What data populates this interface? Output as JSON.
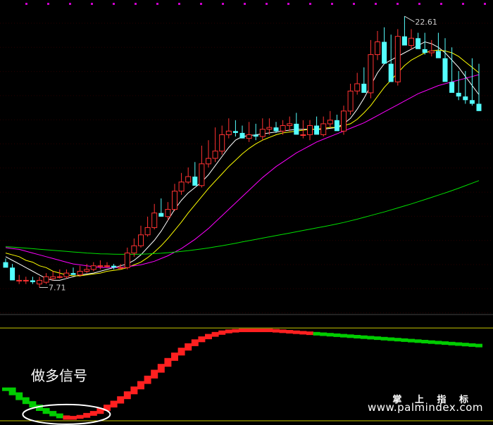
{
  "colors": {
    "background": "#000000",
    "grid": "#2a0000",
    "candle_up": "#ff3232",
    "candle_down": "#54ffff",
    "ma5": "#ffffff",
    "ma10": "#ffff00",
    "ma20": "#ff00ff",
    "ma60": "#00e000",
    "indicator_up": "#ff2020",
    "indicator_down": "#00cc00",
    "indicator_line": "#c8c800",
    "ellipse": "#ffffff",
    "dots": "#cc00cc"
  },
  "annotations": {
    "signal_label": "做多信号",
    "high_label": "22.61",
    "low_label": "7.71"
  },
  "watermark": {
    "name": "掌 上 指 标",
    "url": "www.palmindex.com"
  },
  "chart_data": [
    {
      "type": "candlestick",
      "x": [
        1,
        2,
        3,
        4,
        5,
        6,
        7,
        8,
        9,
        10,
        11,
        12,
        13,
        14,
        15,
        16,
        17,
        18,
        19,
        20,
        21,
        22,
        23,
        24,
        25,
        26,
        27,
        28,
        29,
        30,
        31,
        32,
        33,
        34,
        35,
        36,
        37,
        38,
        39,
        40,
        41,
        42,
        43,
        44,
        45,
        46,
        47,
        48,
        49,
        50,
        51,
        52,
        53,
        54,
        55,
        56,
        57,
        58,
        59,
        60,
        61,
        62,
        63,
        64,
        65,
        66,
        67,
        68,
        69,
        70,
        71
      ],
      "open": [
        9.1,
        8.8,
        8.1,
        8.1,
        8.1,
        7.9,
        8.0,
        8.2,
        8.3,
        8.3,
        8.5,
        8.4,
        8.6,
        8.7,
        8.9,
        8.9,
        8.9,
        8.8,
        8.8,
        9.6,
        10.0,
        10.6,
        11.0,
        11.8,
        11.6,
        12.0,
        13.0,
        13.5,
        13.8,
        13.3,
        14.5,
        14.8,
        15.2,
        16.1,
        16.3,
        16.2,
        15.9,
        16.1,
        16.0,
        16.4,
        16.5,
        16.3,
        16.6,
        16.7,
        16.1,
        16.1,
        16.6,
        16.1,
        16.7,
        16.9,
        16.3,
        17.4,
        18.5,
        18.9,
        18.4,
        20.5,
        21.2,
        20.0,
        19.0,
        21.5,
        21.0,
        21.4,
        20.8,
        20.6,
        20.7,
        20.3,
        19.0,
        18.4,
        18.2,
        18.0,
        17.8
      ],
      "high": [
        9.3,
        9.0,
        8.4,
        8.3,
        8.3,
        8.3,
        8.5,
        8.6,
        8.7,
        8.7,
        8.8,
        8.9,
        9.0,
        9.1,
        9.2,
        9.1,
        9.0,
        9.0,
        9.9,
        10.4,
        11.1,
        11.6,
        12.3,
        12.6,
        12.4,
        13.4,
        14.0,
        14.3,
        14.6,
        15.5,
        15.8,
        16.5,
        16.6,
        17.0,
        16.9,
        16.6,
        16.8,
        16.7,
        17.0,
        17.0,
        16.8,
        16.9,
        17.1,
        17.3,
        16.9,
        16.9,
        17.1,
        17.1,
        17.4,
        17.2,
        17.7,
        18.9,
        19.5,
        19.8,
        21.3,
        21.8,
        22.0,
        21.6,
        21.9,
        22.61,
        21.9,
        21.7,
        21.7,
        21.3,
        21.7,
        21.4,
        20.9,
        19.6,
        19.6,
        20.3,
        20.0
      ],
      "low": [
        8.9,
        8.7,
        7.9,
        7.9,
        7.9,
        7.71,
        7.9,
        8.1,
        8.2,
        8.2,
        8.4,
        8.3,
        8.5,
        8.6,
        8.7,
        8.8,
        8.7,
        8.7,
        8.7,
        9.4,
        9.9,
        10.5,
        10.9,
        11.6,
        11.4,
        11.9,
        12.8,
        13.4,
        13.6,
        13.2,
        14.3,
        14.6,
        15.0,
        15.9,
        16.0,
        15.9,
        15.7,
        15.8,
        15.8,
        16.1,
        16.2,
        16.1,
        16.3,
        16.4,
        15.9,
        15.8,
        16.3,
        16.0,
        16.5,
        16.5,
        16.1,
        17.2,
        18.3,
        18.6,
        18.1,
        20.2,
        20.9,
        19.7,
        18.8,
        21.2,
        20.8,
        21.2,
        20.5,
        20.4,
        20.4,
        20.0,
        18.6,
        18.0,
        17.8,
        17.7,
        17.4
      ],
      "close": [
        8.8,
        8.1,
        8.1,
        8.1,
        8.0,
        8.1,
        8.3,
        8.3,
        8.3,
        8.5,
        8.4,
        8.6,
        8.7,
        8.9,
        8.9,
        8.9,
        8.8,
        8.8,
        9.6,
        10.0,
        10.6,
        11.0,
        11.8,
        11.6,
        12.0,
        13.0,
        13.5,
        13.8,
        13.3,
        14.5,
        14.8,
        15.2,
        16.1,
        16.3,
        16.2,
        15.9,
        16.1,
        16.0,
        16.4,
        16.5,
        16.3,
        16.6,
        16.7,
        16.1,
        16.1,
        16.6,
        16.1,
        16.7,
        16.9,
        16.3,
        17.4,
        18.5,
        18.9,
        18.4,
        20.5,
        21.2,
        20.0,
        19.0,
        21.5,
        21.0,
        21.4,
        20.8,
        20.6,
        20.7,
        20.3,
        19.0,
        18.4,
        18.2,
        18.0,
        17.8,
        17.4
      ],
      "moving_averages": [
        {
          "name": "MA5",
          "values": [
            9.4,
            9.2,
            9.0,
            8.8,
            8.6,
            8.4,
            8.2,
            8.1,
            8.1,
            8.2,
            8.3,
            8.4,
            8.45,
            8.5,
            8.6,
            8.7,
            8.8,
            8.9,
            9.0,
            9.2,
            9.5,
            9.9,
            10.3,
            10.8,
            11.4,
            12.0,
            12.5,
            12.9,
            13.2,
            13.5,
            13.9,
            14.4,
            14.9,
            15.4,
            15.8,
            16.0,
            16.05,
            16.1,
            16.15,
            16.2,
            16.25,
            16.3,
            16.35,
            16.4,
            16.4,
            16.4,
            16.4,
            16.4,
            16.45,
            16.5,
            16.7,
            17.0,
            17.5,
            18.1,
            18.8,
            19.5,
            20.0,
            20.2,
            20.4,
            20.6,
            20.8,
            21.0,
            21.2,
            21.1,
            20.9,
            20.6,
            20.2,
            19.8,
            19.3,
            18.8,
            18.3
          ]
        },
        {
          "name": "MA10",
          "values": [
            9.6,
            9.5,
            9.4,
            9.2,
            9.1,
            8.9,
            8.8,
            8.6,
            8.5,
            8.4,
            8.35,
            8.35,
            8.4,
            8.45,
            8.5,
            8.6,
            8.65,
            8.7,
            8.8,
            8.95,
            9.1,
            9.35,
            9.65,
            10.0,
            10.4,
            10.85,
            11.3,
            11.8,
            12.25,
            12.7,
            13.15,
            13.55,
            13.95,
            14.35,
            14.7,
            15.05,
            15.35,
            15.6,
            15.8,
            15.95,
            16.1,
            16.2,
            16.25,
            16.3,
            16.35,
            16.4,
            16.4,
            16.45,
            16.5,
            16.5,
            16.6,
            16.7,
            16.95,
            17.3,
            17.7,
            18.2,
            18.7,
            19.1,
            19.5,
            19.9,
            20.2,
            20.4,
            20.6,
            20.7,
            20.75,
            20.7,
            20.6,
            20.4,
            20.1,
            19.8,
            19.5
          ]
        },
        {
          "name": "MA20",
          "values": [
            9.9,
            9.85,
            9.8,
            9.7,
            9.6,
            9.5,
            9.4,
            9.3,
            9.2,
            9.1,
            9.0,
            8.95,
            8.9,
            8.85,
            8.8,
            8.8,
            8.8,
            8.8,
            8.85,
            8.9,
            8.95,
            9.05,
            9.15,
            9.3,
            9.45,
            9.65,
            9.85,
            10.1,
            10.35,
            10.65,
            10.95,
            11.3,
            11.65,
            12.0,
            12.35,
            12.7,
            13.05,
            13.4,
            13.75,
            14.05,
            14.35,
            14.6,
            14.85,
            15.1,
            15.3,
            15.5,
            15.7,
            15.85,
            16.0,
            16.15,
            16.3,
            16.45,
            16.6,
            16.75,
            16.95,
            17.15,
            17.35,
            17.55,
            17.75,
            17.95,
            18.15,
            18.35,
            18.5,
            18.65,
            18.8,
            18.9,
            19.0,
            19.1,
            19.2,
            19.3,
            19.4
          ]
        },
        {
          "name": "MA60",
          "values": [
            9.95,
            9.93,
            9.9,
            9.87,
            9.84,
            9.81,
            9.78,
            9.75,
            9.72,
            9.69,
            9.66,
            9.63,
            9.6,
            9.58,
            9.56,
            9.55,
            9.54,
            9.53,
            9.53,
            9.53,
            9.54,
            9.55,
            9.57,
            9.59,
            9.62,
            9.65,
            9.69,
            9.73,
            9.78,
            9.83,
            9.88,
            9.94,
            10.0,
            10.07,
            10.14,
            10.21,
            10.28,
            10.35,
            10.42,
            10.49,
            10.56,
            10.63,
            10.7,
            10.77,
            10.84,
            10.91,
            10.98,
            11.05,
            11.12,
            11.2,
            11.28,
            11.37,
            11.46,
            11.56,
            11.66,
            11.76,
            11.86,
            11.97,
            12.08,
            12.19,
            12.3,
            12.42,
            12.54,
            12.66,
            12.78,
            12.9,
            13.03,
            13.16,
            13.3,
            13.44,
            13.58
          ]
        }
      ],
      "ylim": [
        6.3,
        23.5
      ],
      "high_marker": {
        "x": 60,
        "value": 22.61
      },
      "low_marker": {
        "x": 6,
        "value": 7.71
      }
    },
    {
      "type": "bar",
      "x": [
        1,
        2,
        3,
        4,
        5,
        6,
        7,
        8,
        9,
        10,
        11,
        12,
        13,
        14,
        15,
        16,
        17,
        18,
        19,
        20,
        21,
        22,
        23,
        24,
        25,
        26,
        27,
        28,
        29,
        30,
        31,
        32,
        33,
        34,
        35,
        36,
        37,
        38,
        39,
        40,
        41,
        42,
        43,
        44,
        45,
        46,
        47,
        48,
        49,
        50,
        51,
        52,
        53,
        54,
        55,
        56,
        57,
        58,
        59,
        60,
        61,
        62,
        63,
        64,
        65,
        66,
        67,
        68,
        69,
        70,
        71
      ],
      "values": [
        -0.1,
        -0.2,
        -0.3,
        -0.38,
        -0.45,
        -0.52,
        -0.58,
        -0.63,
        -0.67,
        -0.7,
        -0.68,
        -0.66,
        -0.62,
        -0.58,
        -0.52,
        -0.45,
        -0.37,
        -0.28,
        -0.18,
        -0.08,
        0.03,
        0.14,
        0.26,
        0.38,
        0.5,
        0.61,
        0.71,
        0.8,
        0.88,
        0.94,
        0.99,
        1.03,
        1.06,
        1.08,
        1.09,
        1.1,
        1.1,
        1.1,
        1.1,
        1.09,
        1.08,
        1.07,
        1.06,
        1.05,
        1.04,
        1.03,
        1.02,
        1.01,
        1.0,
        0.99,
        0.98,
        0.97,
        0.96,
        0.95,
        0.94,
        0.93,
        0.92,
        0.91,
        0.9,
        0.89,
        0.88,
        0.87,
        0.86,
        0.85,
        0.84,
        0.83,
        0.82,
        0.81,
        0.8,
        0.79,
        0.78
      ],
      "direction": [
        "down",
        "down",
        "down",
        "down",
        "down",
        "down",
        "down",
        "down",
        "down",
        "up",
        "up",
        "up",
        "up",
        "up",
        "up",
        "up",
        "up",
        "up",
        "up",
        "up",
        "up",
        "up",
        "up",
        "up",
        "up",
        "up",
        "up",
        "up",
        "up",
        "up",
        "up",
        "up",
        "up",
        "up",
        "up",
        "up",
        "up",
        "up",
        "up",
        "up",
        "up",
        "up",
        "up",
        "up",
        "up",
        "up",
        "down",
        "down",
        "down",
        "down",
        "down",
        "down",
        "down",
        "down",
        "down",
        "down",
        "down",
        "down",
        "down",
        "down",
        "down",
        "down",
        "down",
        "down",
        "down",
        "down",
        "down",
        "down",
        "down",
        "down",
        "down"
      ],
      "reference_line": 1.14,
      "ylim": [
        -0.75,
        1.3
      ],
      "signal": {
        "x_start": 5,
        "x_end": 15
      }
    }
  ]
}
